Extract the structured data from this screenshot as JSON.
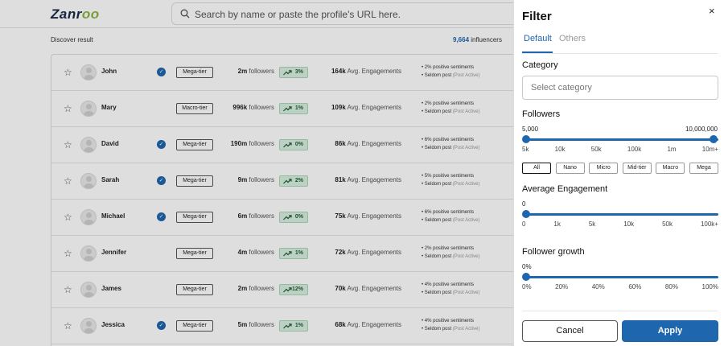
{
  "brand": {
    "logo_text": "Zanroo"
  },
  "search": {
    "placeholder": "Search by name or paste the profile's URL here."
  },
  "results": {
    "label": "Discover result",
    "count": "9,664",
    "count_suffix": " influencers",
    "followers_suffix": " followers",
    "engagement_suffix": " Avg. Engagements",
    "rows": [
      {
        "name": "John",
        "verified": true,
        "tier": "Mega-tier",
        "followers": "2m",
        "growth": "3%",
        "engagement": "164k",
        "sentiment": "2% positive sentiments",
        "post_freq": "Seldom post",
        "post_note": "(Post Active)"
      },
      {
        "name": "Mary",
        "verified": false,
        "tier": "Macro-tier",
        "followers": "996k",
        "growth": "1%",
        "engagement": "109k",
        "sentiment": "2% positive sentiments",
        "post_freq": "Seldom post",
        "post_note": "(Post Active)"
      },
      {
        "name": "David",
        "verified": true,
        "tier": "Mega-tier",
        "followers": "190m",
        "growth": "0%",
        "engagement": "86k",
        "sentiment": "6% positive sentiments",
        "post_freq": "Seldom post",
        "post_note": "(Post Active)"
      },
      {
        "name": "Sarah",
        "verified": true,
        "tier": "Mega-tier",
        "followers": "9m",
        "growth": "2%",
        "engagement": "81k",
        "sentiment": "5% positive sentiments",
        "post_freq": "Seldom post",
        "post_note": "(Post Active)"
      },
      {
        "name": "Michael",
        "verified": true,
        "tier": "Mega-tier",
        "followers": "6m",
        "growth": "0%",
        "engagement": "75k",
        "sentiment": "6% positive sentiments",
        "post_freq": "Seldom post",
        "post_note": "(Post Active)"
      },
      {
        "name": "Jennifer",
        "verified": false,
        "tier": "Mega-tier",
        "followers": "4m",
        "growth": "1%",
        "engagement": "72k",
        "sentiment": "2% positive sentiments",
        "post_freq": "Seldom post",
        "post_note": "(Post Active)"
      },
      {
        "name": "James",
        "verified": false,
        "tier": "Mega-tier",
        "followers": "2m",
        "growth": "12%",
        "engagement": "70k",
        "sentiment": "4% positive sentiments",
        "post_freq": "Seldom post",
        "post_note": "(Post Active)"
      },
      {
        "name": "Jessica",
        "verified": true,
        "tier": "Mega-tier",
        "followers": "5m",
        "growth": "1%",
        "engagement": "68k",
        "sentiment": "4% positive sentiments",
        "post_freq": "Seldom post",
        "post_note": "(Post Active)"
      }
    ]
  },
  "filter": {
    "title": "Filter",
    "close_symbol": "×",
    "tabs": [
      {
        "label": "Default",
        "active": true
      },
      {
        "label": "Others",
        "active": false
      }
    ],
    "category": {
      "label": "Category",
      "placeholder": "Select category"
    },
    "followers": {
      "label": "Followers",
      "min_value": "5,000",
      "max_value": "10,000,000",
      "ticks": [
        "5k",
        "10k",
        "50k",
        "100k",
        "1m",
        "10m+"
      ],
      "sizes": [
        "All",
        "Nano",
        "Micro",
        "Mid-tier",
        "Macro",
        "Mega"
      ],
      "selected_size": "All"
    },
    "engagement": {
      "label": "Average Engagement",
      "value": "0",
      "ticks": [
        "0",
        "1k",
        "5k",
        "10k",
        "50k",
        "100k+"
      ]
    },
    "growth": {
      "label": "Follower growth",
      "value": "0%",
      "ticks": [
        "0%",
        "20%",
        "40%",
        "60%",
        "80%",
        "100%"
      ]
    },
    "cancel_label": "Cancel",
    "apply_label": "Apply"
  },
  "colors": {
    "accent": "#1e66ad",
    "growth_bg": "#d8f0e2",
    "growth_text": "#1f5d33"
  },
  "icons": {
    "search": "search-icon",
    "star": "star-icon",
    "verified": "verified-check-icon",
    "trend": "trending-up-icon",
    "close": "close-icon"
  }
}
